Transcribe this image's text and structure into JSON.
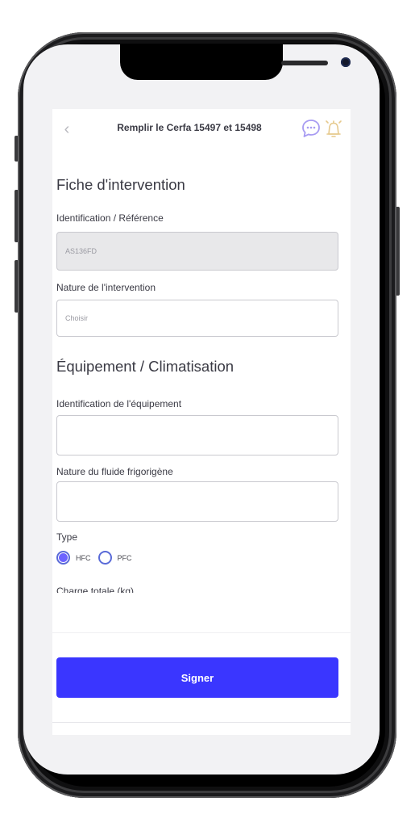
{
  "header": {
    "back_icon": "chevron-left-icon",
    "title": "Remplir le Cerfa 15497 et 15498",
    "chat_icon": "chat-bubble-icon",
    "alarm_icon": "alarm-clock-icon"
  },
  "intervention": {
    "title": "Fiche d'intervention",
    "identification_label": "Identification / Référence",
    "identification_value": "AS136FD",
    "nature_label": "Nature de l'intervention",
    "nature_value": "Choisir"
  },
  "equipment": {
    "title": "Équipement / Climatisation",
    "identification_label": "Identification de l'équipement",
    "identification_value": "",
    "fluid_label": "Nature du fluide frigorigène",
    "fluid_value": "",
    "type_label": "Type",
    "type_options": [
      {
        "label": "HFC",
        "selected": true
      },
      {
        "label": "PFC",
        "selected": false
      }
    ],
    "charge_label": "Charge totale (kg)"
  },
  "footer": {
    "sign_label": "Signer"
  },
  "colors": {
    "primary": "#3a36ff",
    "radio_selected": "#6c63ff",
    "icon_accent": "#a79bf2"
  }
}
